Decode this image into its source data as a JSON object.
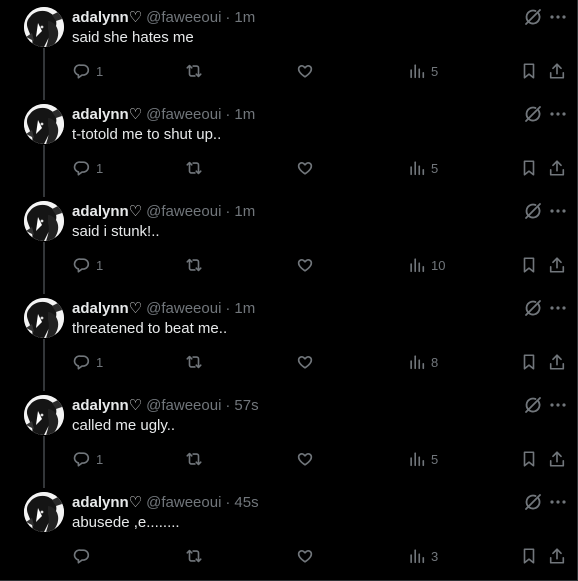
{
  "colors": {
    "background": "#000000",
    "text_primary": "#e7e9ea",
    "text_secondary": "#71767b",
    "thread_line": "#333639"
  },
  "tweets": [
    {
      "display_name": "adalynn♡",
      "handle": "@faweeoui",
      "separator": "·",
      "time": "1m",
      "text": "said she hates me",
      "reply_count": "1",
      "view_count": "5",
      "has_thread_line": true,
      "actions": {
        "reply_icon": "reply-icon",
        "retweet_icon": "retweet-icon",
        "like_icon": "heart-icon",
        "views_icon": "views-icon",
        "bookmark_icon": "bookmark-icon",
        "share_icon": "share-icon"
      }
    },
    {
      "display_name": "adalynn♡",
      "handle": "@faweeoui",
      "separator": "·",
      "time": "1m",
      "text": "t-totold me to shut up..",
      "reply_count": "1",
      "view_count": "5",
      "has_thread_line": true
    },
    {
      "display_name": "adalynn♡",
      "handle": "@faweeoui",
      "separator": "·",
      "time": "1m",
      "text": "said i stunk!..",
      "reply_count": "1",
      "view_count": "10",
      "has_thread_line": true
    },
    {
      "display_name": "adalynn♡",
      "handle": "@faweeoui",
      "separator": "·",
      "time": "1m",
      "text": "threatened to beat me..",
      "reply_count": "1",
      "view_count": "8",
      "has_thread_line": true
    },
    {
      "display_name": "adalynn♡",
      "handle": "@faweeoui",
      "separator": "·",
      "time": "57s",
      "text": "called me ugly..",
      "reply_count": "1",
      "view_count": "5",
      "has_thread_line": true
    },
    {
      "display_name": "adalynn♡",
      "handle": "@faweeoui",
      "separator": "·",
      "time": "45s",
      "text": "abusede ,e........",
      "reply_count": "",
      "view_count": "3",
      "has_thread_line": false
    }
  ]
}
